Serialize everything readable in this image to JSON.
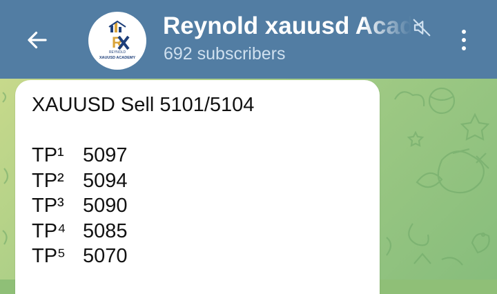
{
  "header": {
    "title": "Reynold xauusd Academy",
    "subscribers": "692 subscribers",
    "avatar": {
      "logo_text": "RX",
      "brand_text": "REYNOLD",
      "sub_text": "XAUUSD ACADEMY"
    }
  },
  "message": {
    "headline": "XAUUSD Sell 5101/5104",
    "targets": [
      {
        "label": "TP¹",
        "value": "5097"
      },
      {
        "label": "TP²",
        "value": "5094"
      },
      {
        "label": "TP³",
        "value": "5090"
      },
      {
        "label": "TP⁴",
        "value": "5085"
      },
      {
        "label": "TP⁵",
        "value": "5070"
      }
    ]
  },
  "colors": {
    "header_bg": "#527da3",
    "chat_bg": "#8fbf77",
    "bubble_bg": "#ffffff",
    "logo_gold": "#d9a43a",
    "logo_navy": "#1e3f7a"
  },
  "icons": {
    "back": "arrow-left-icon",
    "mute": "muted-speaker-icon",
    "menu": "more-vertical-icon"
  }
}
